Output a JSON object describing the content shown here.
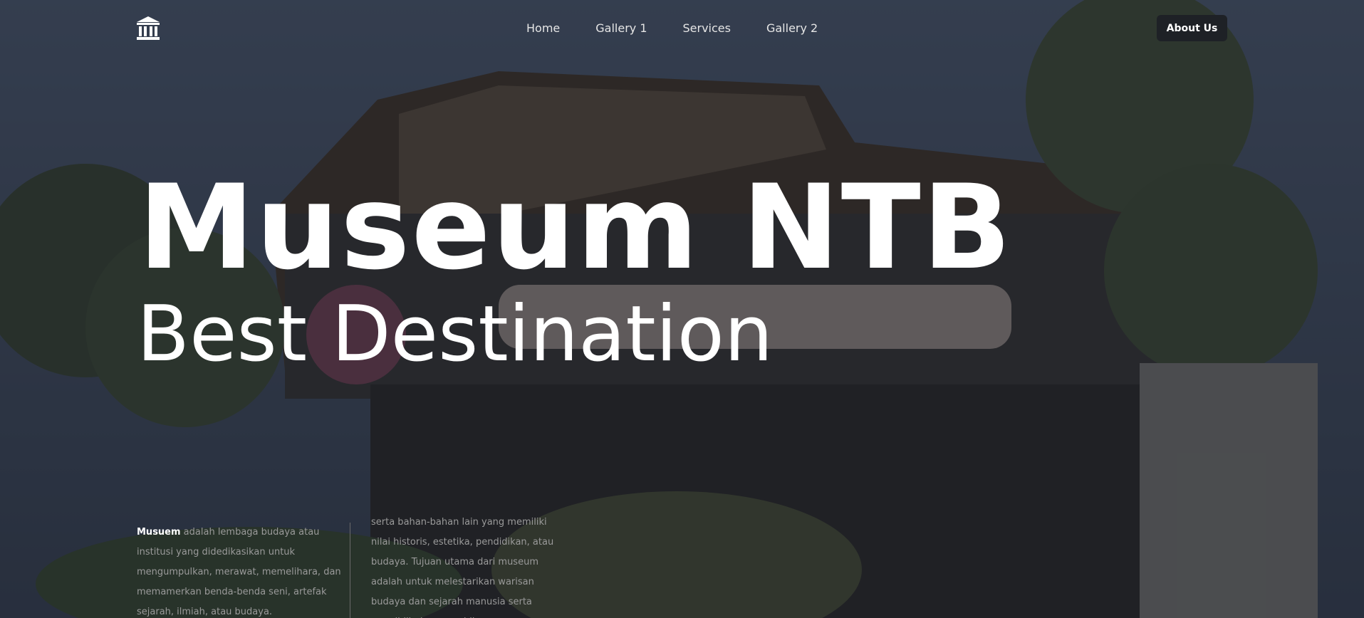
{
  "header": {
    "logo_icon": "museum-building-icon",
    "nav": [
      "Home",
      "Gallery 1",
      "Services",
      "Gallery 2"
    ],
    "about_label": "About Us"
  },
  "hero": {
    "title": "Museum NTB",
    "subtitle": "Best Destination"
  },
  "description": {
    "left_bold": "Musuem",
    "left_text": " adalah lembaga budaya atau institusi yang didedikasikan untuk mengumpulkan, merawat, memelihara, dan memamerkan benda-benda seni, artefak sejarah, ilmiah, atau budaya.",
    "right_text": "serta bahan-bahan lain yang memiliki nilai historis, estetika, pendidikan, atau budaya. Tujuan utama dari museum adalah untuk melestarikan warisan budaya dan sejarah manusia serta mendidik dan menghibur"
  },
  "colors": {
    "overlay": "#161a22",
    "button_bg": "#1e2126",
    "text_primary": "#ffffff",
    "text_muted": "#9a9a9a"
  }
}
